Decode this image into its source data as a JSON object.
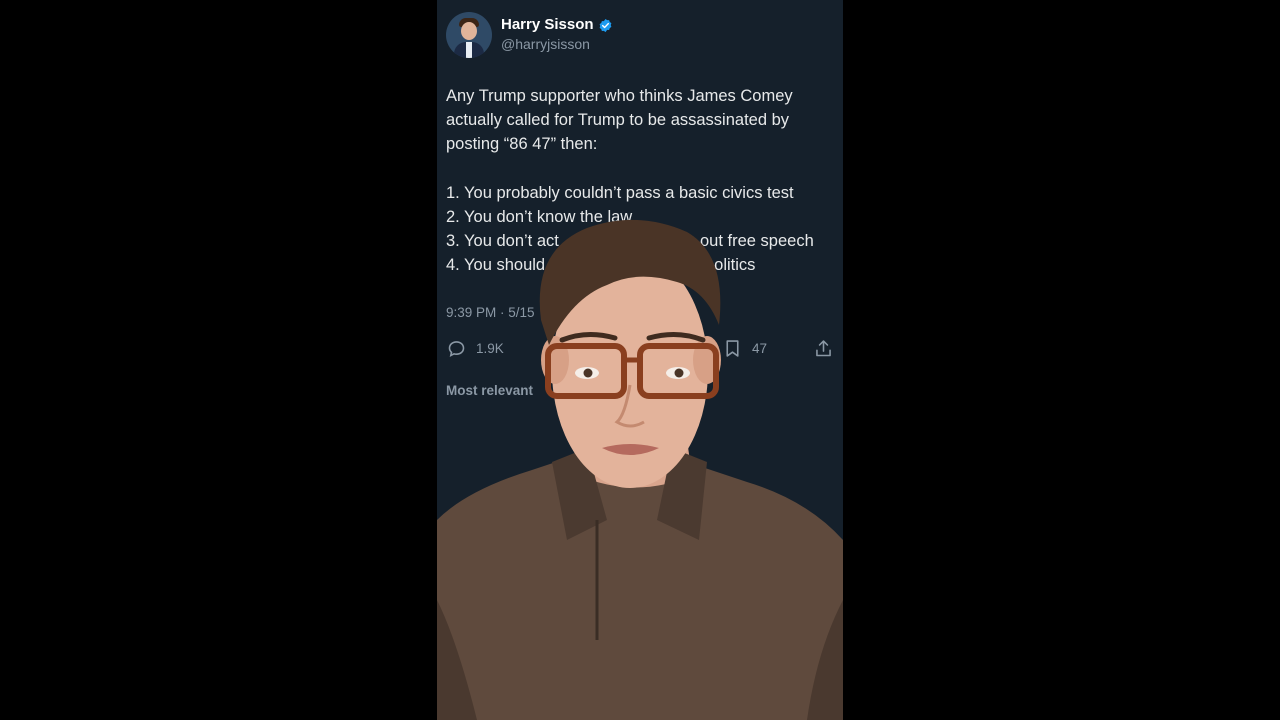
{
  "author": {
    "name": "Harry Sisson",
    "handle": "@harryjsisson",
    "verified_icon": "verified-badge-icon"
  },
  "tweet": {
    "intro_lines": [
      "Any Trump supporter who thinks James Comey",
      "actually called for Trump to be assassinated by",
      "posting “86 47” then:"
    ],
    "list_lines": [
      "1. You probably couldn’t pass a basic civics test",
      "2. You don’t know the law",
      "3. You don’t act",
      "4. You should"
    ],
    "list_line_tails": [
      "",
      "",
      "out free speech",
      "politics"
    ],
    "timestamp": "9:39 PM · 5/15"
  },
  "actions": {
    "reply_count": "1.9K",
    "bookmark_count": "47"
  },
  "replies_sort_label": "Most relevant",
  "colors": {
    "background": "#15202b",
    "text": "#e7e9ea",
    "muted": "#8b98a5",
    "accent": "#1d9bf0"
  }
}
